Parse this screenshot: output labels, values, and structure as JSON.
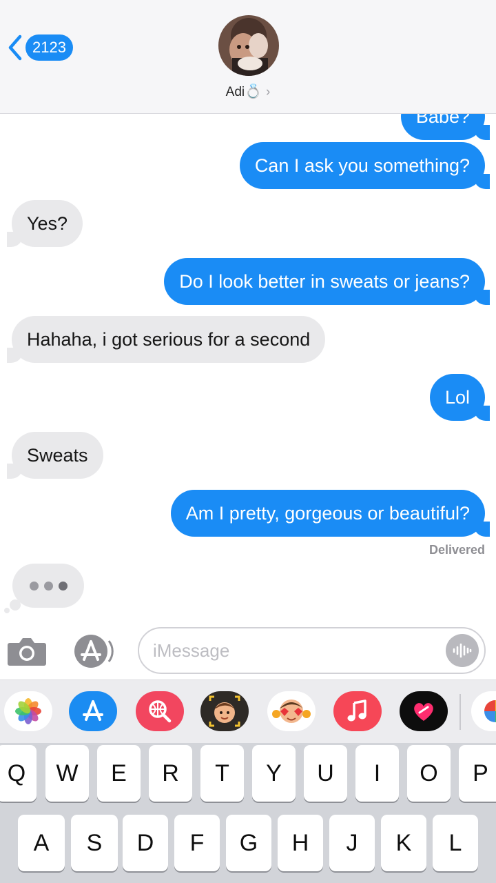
{
  "header": {
    "back_count": "2123",
    "contact_name": "Adi",
    "contact_emoji": "💍"
  },
  "messages": [
    {
      "side": "out",
      "text": "Babe?"
    },
    {
      "side": "out",
      "text": "Can I ask you something?"
    },
    {
      "side": "in",
      "text": "Yes?"
    },
    {
      "side": "out",
      "text": "Do I look better in sweats or jeans?"
    },
    {
      "side": "in",
      "text": "Hahaha, i got serious for a second"
    },
    {
      "side": "out",
      "text": "Lol"
    },
    {
      "side": "in",
      "text": "Sweats"
    },
    {
      "side": "out",
      "text": "Am I pretty, gorgeous or beautiful?"
    }
  ],
  "status": "Delivered",
  "typing_indicator": true,
  "compose": {
    "placeholder": "iMessage",
    "value": ""
  },
  "app_strip": [
    "photos-app-icon",
    "app-store-icon",
    "image-search-icon",
    "memoji-icon",
    "animoji-stickers-icon",
    "music-app-icon",
    "digital-touch-icon",
    "activity-app-icon"
  ],
  "keyboard": {
    "row1": [
      "Q",
      "W",
      "E",
      "R",
      "T",
      "Y",
      "U",
      "I",
      "O",
      "P"
    ],
    "row2": [
      "A",
      "S",
      "D",
      "F",
      "G",
      "H",
      "J",
      "K",
      "L"
    ]
  },
  "colors": {
    "outgoing_bubble": "#1a8cf5",
    "incoming_bubble": "#e9e9eb",
    "accent": "#1a8cf5"
  }
}
